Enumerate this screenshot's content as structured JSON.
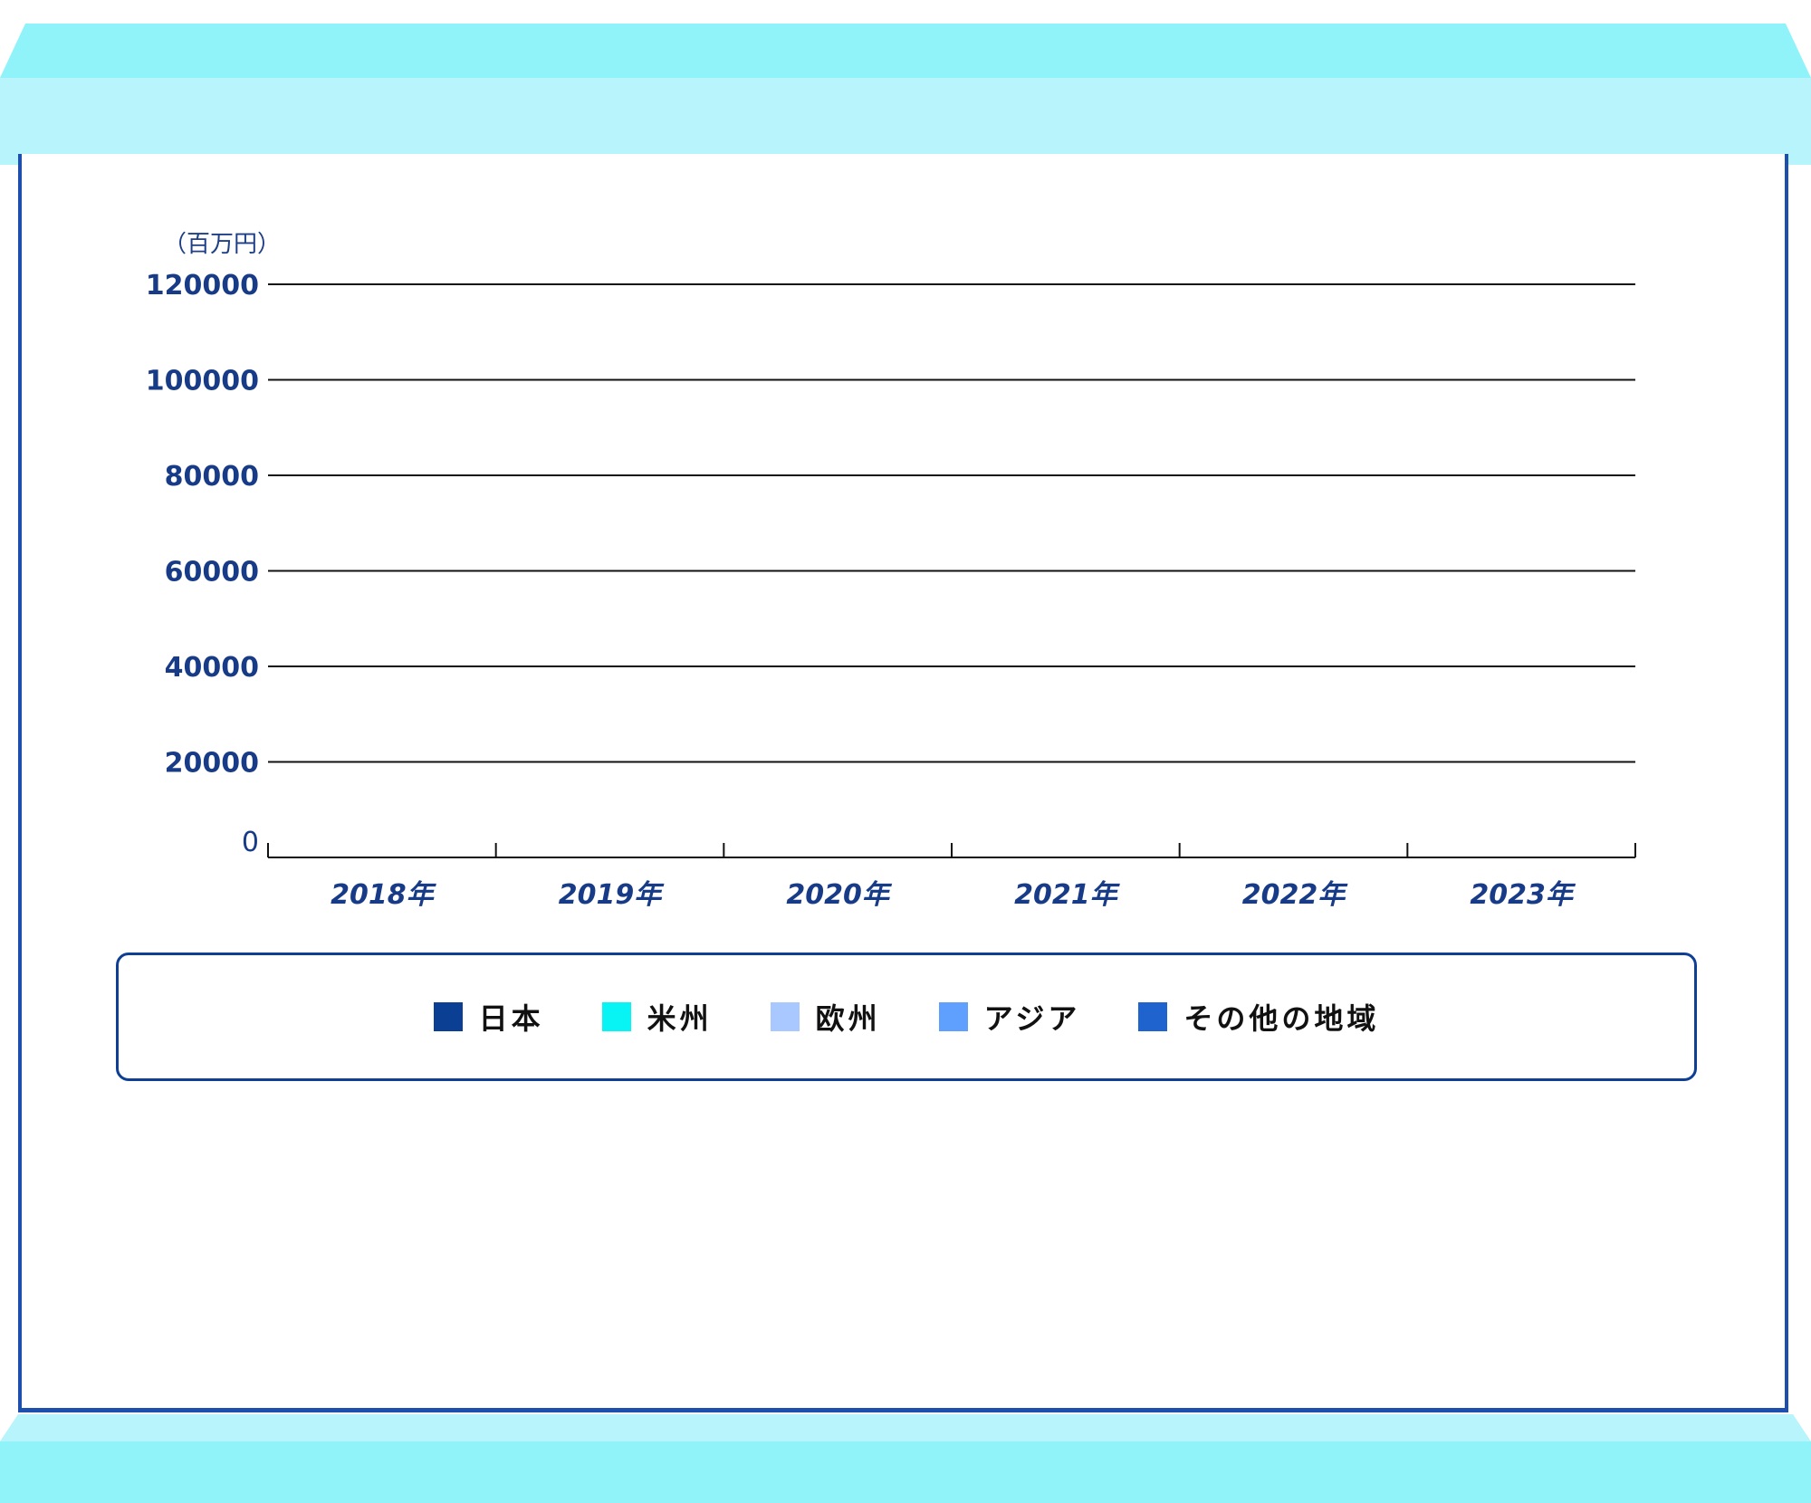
{
  "chart_data": {
    "type": "bar",
    "title": "",
    "ylabel": "（百万円）",
    "xlabel": "",
    "categories": [
      "2018年",
      "2019年",
      "2020年",
      "2021年",
      "2022年",
      "2023年"
    ],
    "ylim": [
      0,
      120000
    ],
    "yticks": [
      "0",
      "20000",
      "40000",
      "60000",
      "80000",
      "100000",
      "120000"
    ],
    "series": [
      {
        "name": "日本",
        "color": "#0b3f94",
        "values": [
          0,
          0,
          0,
          0,
          0,
          0
        ]
      },
      {
        "name": "米州",
        "color": "#08f4f4",
        "values": [
          0,
          0,
          0,
          0,
          0,
          0
        ]
      },
      {
        "name": "欧州",
        "color": "#a9c8ff",
        "values": [
          0,
          0,
          0,
          0,
          0,
          0
        ]
      },
      {
        "name": "アジア",
        "color": "#5fa0ff",
        "values": [
          0,
          0,
          0,
          0,
          0,
          0
        ]
      },
      {
        "name": "その他の地域",
        "color": "#1f63cf",
        "values": [
          0,
          0,
          0,
          0,
          0,
          0
        ]
      }
    ],
    "grid": true,
    "legend": "bottom"
  }
}
